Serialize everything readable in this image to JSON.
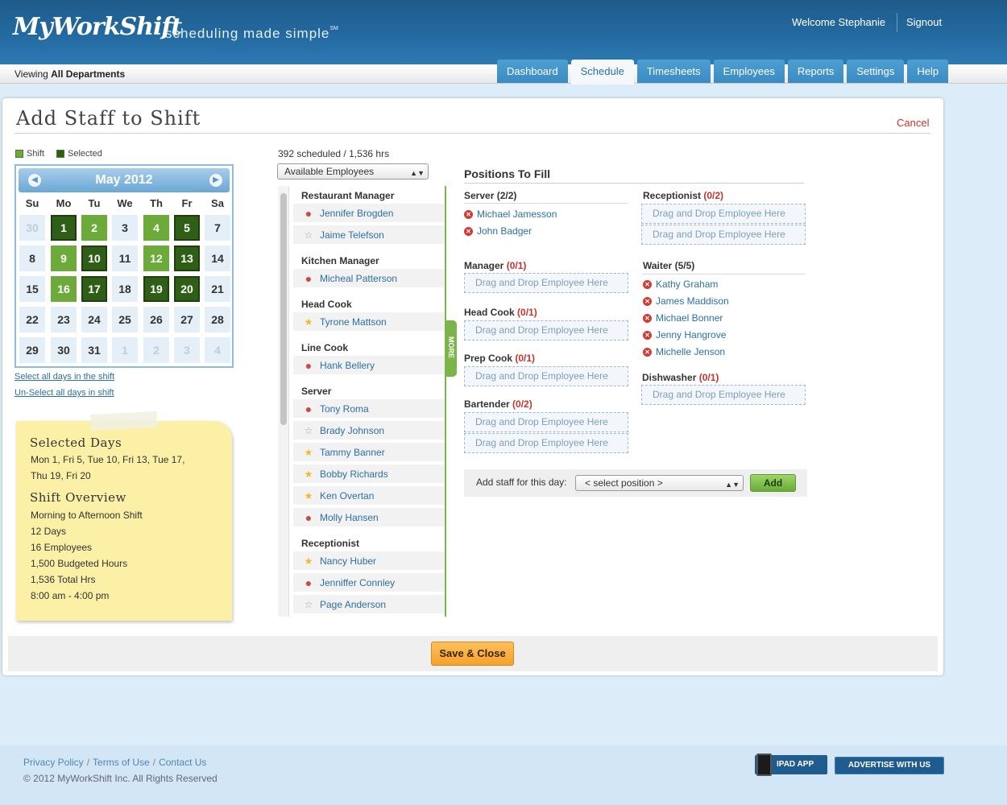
{
  "header": {
    "logo_text": "MyWorkShift",
    "tagline": "scheduling made simple",
    "tagline_mark": "SM",
    "welcome": "Welcome Stephanie",
    "signout": "Signout"
  },
  "subbar": {
    "viewing_prefix": "Viewing ",
    "viewing_value": "All Departments"
  },
  "tabs": [
    {
      "label": "Dashboard"
    },
    {
      "label": "Schedule",
      "active": true
    },
    {
      "label": "Timesheets"
    },
    {
      "label": "Employees"
    },
    {
      "label": "Reports"
    },
    {
      "label": "Settings"
    },
    {
      "label": "Help"
    }
  ],
  "page": {
    "title": "Add Staff to Shift",
    "cancel": "Cancel"
  },
  "legend": {
    "shift": "Shift",
    "selected": "Selected"
  },
  "colors": {
    "shift": "#6cab3a",
    "selected": "#2f5e16",
    "accent": "#2b6fa6",
    "danger": "#c5352b"
  },
  "calendar": {
    "month": "May 2012",
    "weekdays": [
      "Su",
      "Mo",
      "Tu",
      "We",
      "Th",
      "Fr",
      "Sa"
    ],
    "weeks": [
      [
        {
          "d": "30",
          "s": "other"
        },
        {
          "d": "1",
          "s": "sel"
        },
        {
          "d": "2",
          "s": "shift"
        },
        {
          "d": "3",
          "s": ""
        },
        {
          "d": "4",
          "s": "shift"
        },
        {
          "d": "5",
          "s": "sel"
        },
        {
          "d": "7",
          "s": ""
        }
      ],
      [
        {
          "d": "8",
          "s": ""
        },
        {
          "d": "9",
          "s": "shift"
        },
        {
          "d": "10",
          "s": "sel"
        },
        {
          "d": "11",
          "s": ""
        },
        {
          "d": "12",
          "s": "shift"
        },
        {
          "d": "13",
          "s": "sel"
        },
        {
          "d": "14",
          "s": ""
        }
      ],
      [
        {
          "d": "15",
          "s": ""
        },
        {
          "d": "16",
          "s": "shift"
        },
        {
          "d": "17",
          "s": "sel"
        },
        {
          "d": "18",
          "s": ""
        },
        {
          "d": "19",
          "s": "sel"
        },
        {
          "d": "20",
          "s": "sel"
        },
        {
          "d": "21",
          "s": ""
        }
      ],
      [
        {
          "d": "22",
          "s": ""
        },
        {
          "d": "23",
          "s": ""
        },
        {
          "d": "24",
          "s": ""
        },
        {
          "d": "25",
          "s": ""
        },
        {
          "d": "26",
          "s": ""
        },
        {
          "d": "27",
          "s": ""
        },
        {
          "d": "28",
          "s": ""
        }
      ],
      [
        {
          "d": "29",
          "s": ""
        },
        {
          "d": "30",
          "s": ""
        },
        {
          "d": "31",
          "s": ""
        },
        {
          "d": "1",
          "s": "other"
        },
        {
          "d": "2",
          "s": "other"
        },
        {
          "d": "3",
          "s": "other"
        },
        {
          "d": "4",
          "s": "other"
        }
      ]
    ],
    "select_all": "Select all days in the shift",
    "unselect_all": "Un-Select all days in shift"
  },
  "note": {
    "selected_days_heading": "Selected Days",
    "selected_days_line1": "Mon 1, Fri 5, Tue 10, Fri 13, Tue 17,",
    "selected_days_line2": "Thu 19, Fri 20",
    "overview_heading": "Shift Overview",
    "overview": [
      "Morning to Afternoon Shift",
      "12 Days",
      "16 Employees",
      "1,500 Budgeted Hours",
      "1,536 Total Hrs",
      "8:00 am - 4:00 pm"
    ]
  },
  "employees": {
    "summary": "392 scheduled / 1,536 hrs",
    "filter": "Available Employees",
    "more": "MORE",
    "groups": [
      {
        "name": "Restaurant Manager",
        "items": [
          {
            "name": "Jennifer Brogden",
            "mark": "dot"
          },
          {
            "name": "Jaime Telefson",
            "mark": "star-gray"
          }
        ]
      },
      {
        "name": "Kitchen Manager",
        "items": [
          {
            "name": "Micheal Patterson",
            "mark": "dot"
          }
        ]
      },
      {
        "name": "Head Cook",
        "items": [
          {
            "name": "Tyrone Mattson",
            "mark": "star-gold"
          }
        ]
      },
      {
        "name": "Line Cook",
        "items": [
          {
            "name": "Hank Bellery",
            "mark": "dot"
          }
        ]
      },
      {
        "name": "Server",
        "items": [
          {
            "name": "Tony Roma",
            "mark": "dot"
          },
          {
            "name": "Brady Johnson",
            "mark": "star-gray"
          },
          {
            "name": "Tammy Banner",
            "mark": "star-gold"
          },
          {
            "name": "Bobby Richards",
            "mark": "star-gold"
          },
          {
            "name": "Ken Overtan",
            "mark": "star-gold"
          },
          {
            "name": "Molly Hansen",
            "mark": "dot"
          }
        ]
      },
      {
        "name": "Receptionist",
        "items": [
          {
            "name": "Nancy Huber",
            "mark": "star-gold"
          },
          {
            "name": "Jenniffer Connley",
            "mark": "dot"
          },
          {
            "name": "Page Anderson",
            "mark": "star-gray"
          }
        ]
      }
    ]
  },
  "positions": {
    "title": "Positions To Fill",
    "drop_text": "Drag and Drop Employee Here",
    "server": {
      "name": "Server",
      "count": "(2/2)",
      "assigned": [
        "Michael Jamesson",
        "John Badger"
      ]
    },
    "receptionist": {
      "name": "Receptionist",
      "count": "(0/2)"
    },
    "manager": {
      "name": "Manager",
      "count": "(0/1)"
    },
    "waiter": {
      "name": "Waiter",
      "count": "(5/5)",
      "assigned": [
        "Kathy Graham",
        "James Maddison",
        "Michael Bonner",
        "Jenny Hangrove",
        "Michelle Jenson"
      ]
    },
    "head_cook": {
      "name": "Head Cook",
      "count": "(0/1)"
    },
    "prep_cook": {
      "name": "Prep Cook",
      "count": "(0/1)"
    },
    "dishwasher": {
      "name": "Dishwasher",
      "count": "(0/1)"
    },
    "bartender": {
      "name": "Bartender",
      "count": "(0/2)"
    }
  },
  "add_staff": {
    "label": "Add staff for this day:",
    "select_value": "< select position >",
    "add_button": "Add"
  },
  "save_button": "Save & Close",
  "footer": {
    "links": [
      "Privacy Policy",
      "Terms of Use",
      "Contact Us"
    ],
    "copyright": "© 2012 MyWorkShift Inc.  All Rights Reserved",
    "ipad_app": "IPAD APP",
    "advertise": "ADVERTISE WITH US"
  }
}
